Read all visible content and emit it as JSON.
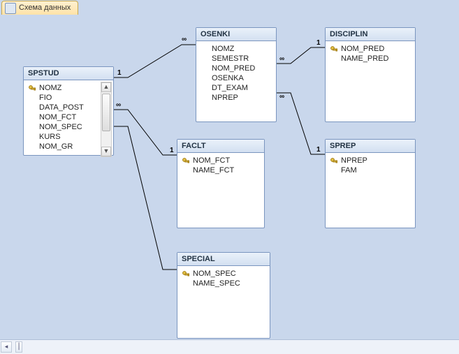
{
  "tab_title": "Схема данных",
  "tables": {
    "spstud": {
      "title": "SPSTUD",
      "fields": [
        {
          "name": "NOMZ",
          "pk": true
        },
        {
          "name": "FIO",
          "pk": false
        },
        {
          "name": "DATA_POST",
          "pk": false
        },
        {
          "name": "NOM_FCT",
          "pk": false
        },
        {
          "name": "NOM_SPEC",
          "pk": false
        },
        {
          "name": "KURS",
          "pk": false
        },
        {
          "name": "NOM_GR",
          "pk": false
        }
      ]
    },
    "osenki": {
      "title": "OSENKI",
      "fields": [
        {
          "name": "NOMZ",
          "pk": false
        },
        {
          "name": "SEMESTR",
          "pk": false
        },
        {
          "name": "NOM_PRED",
          "pk": false
        },
        {
          "name": "OSENKA",
          "pk": false
        },
        {
          "name": "DT_EXAM",
          "pk": false
        },
        {
          "name": "NPREP",
          "pk": false
        }
      ]
    },
    "disciplin": {
      "title": "DISCIPLIN",
      "fields": [
        {
          "name": "NOM_PRED",
          "pk": true
        },
        {
          "name": "NAME_PRED",
          "pk": false
        }
      ]
    },
    "faclt": {
      "title": "FACLT",
      "fields": [
        {
          "name": "NOM_FCT",
          "pk": true
        },
        {
          "name": "NAME_FCT",
          "pk": false
        }
      ]
    },
    "sprep": {
      "title": "SPREP",
      "fields": [
        {
          "name": "NPREP",
          "pk": true
        },
        {
          "name": "FAM",
          "pk": false
        }
      ]
    },
    "special": {
      "title": "SPECIAL",
      "fields": [
        {
          "name": "NOM_SPEC",
          "pk": true
        },
        {
          "name": "NAME_SPEC",
          "pk": false
        }
      ]
    }
  },
  "relations": {
    "one": "1",
    "many": "∞"
  }
}
